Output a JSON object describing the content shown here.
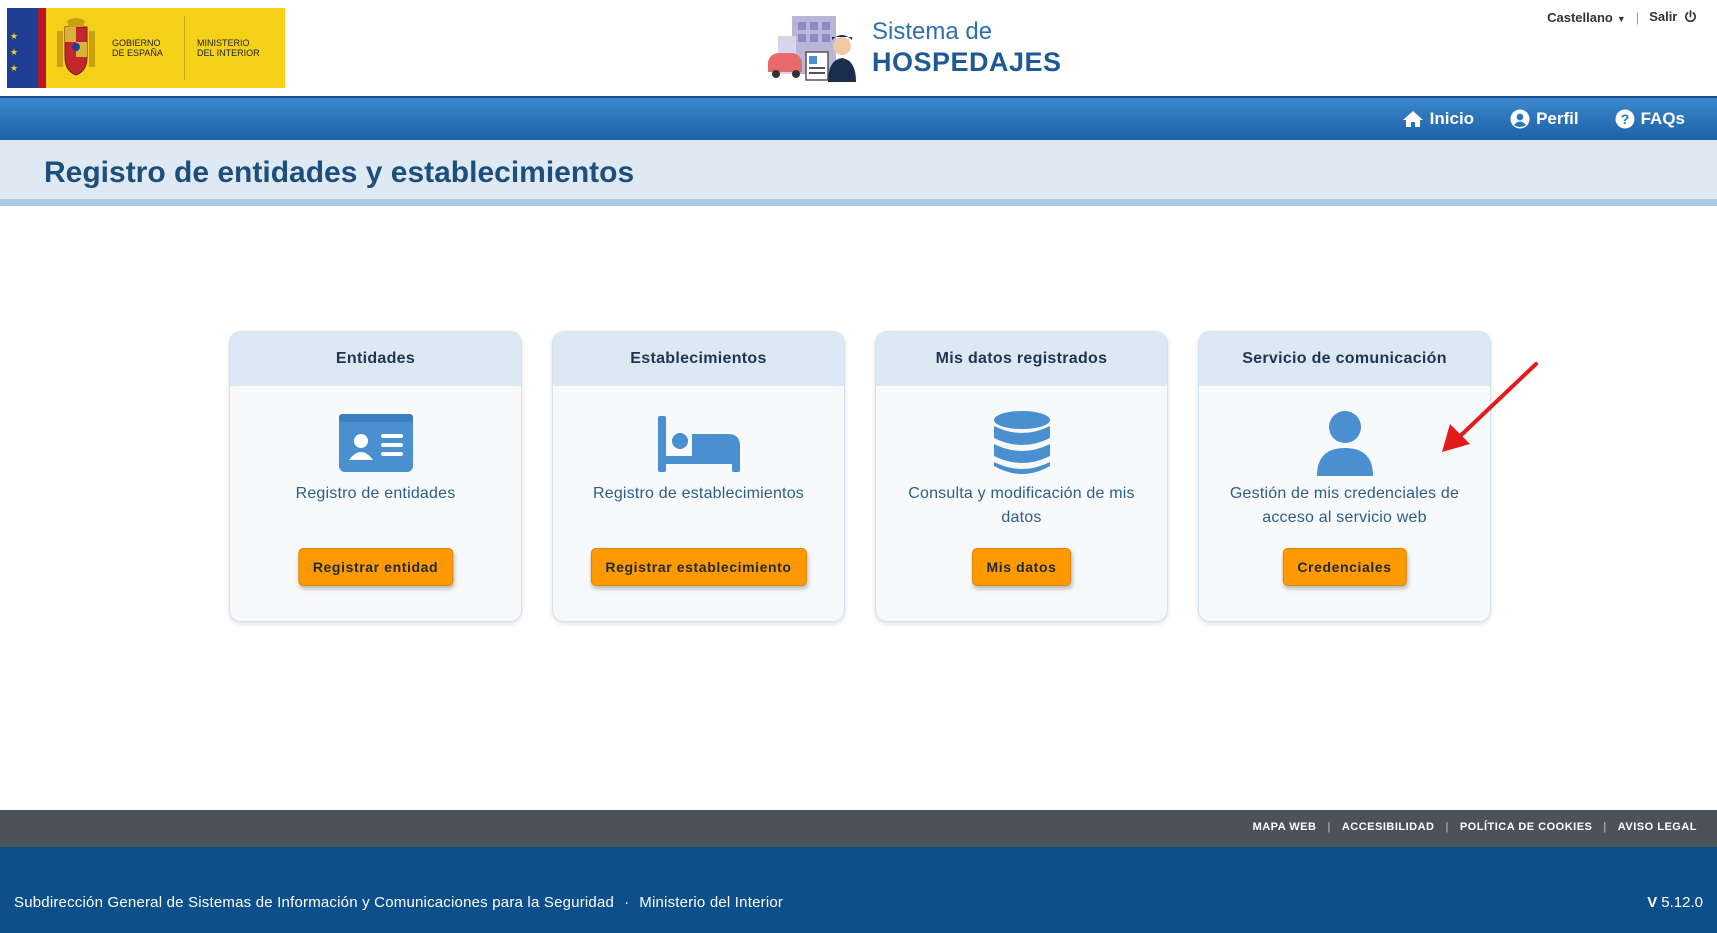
{
  "header": {
    "gov_logo": {
      "line1": "GOBIERNO",
      "line2": "DE ESPAÑA",
      "line3": "MINISTERIO",
      "line4": "DEL INTERIOR"
    },
    "brand": {
      "title_line1": "Sistema de",
      "title_line2": "HOSPEDAJES"
    },
    "language": "Castellano",
    "logout": "Salir"
  },
  "nav": {
    "items": [
      {
        "label": "Inicio",
        "icon": "home-icon"
      },
      {
        "label": "Perfil",
        "icon": "user-circle-icon"
      },
      {
        "label": "FAQs",
        "icon": "question-circle-icon"
      }
    ]
  },
  "page": {
    "title": "Registro de entidades y establecimientos"
  },
  "cards": [
    {
      "title": "Entidades",
      "icon": "id-card-icon",
      "description": "Registro de entidades",
      "button": "Registrar entidad"
    },
    {
      "title": "Establecimientos",
      "icon": "bed-icon",
      "description": "Registro de establecimientos",
      "button": "Registrar establecimiento"
    },
    {
      "title": "Mis datos registrados",
      "icon": "database-icon",
      "description": "Consulta y modificación de mis datos",
      "button": "Mis datos"
    },
    {
      "title": "Servicio de comunicación",
      "icon": "user-icon",
      "description": "Gestión de mis credenciales de acceso al servicio web",
      "button": "Credenciales"
    }
  ],
  "colors": {
    "accent_button": "#ff9900",
    "navbar": "#2c74ba",
    "title_band": "#dfe9f4",
    "footer": "#0d4f8b",
    "icon_blue": "#4a8fcf",
    "annotation_arrow": "#e31b1b"
  },
  "footer": {
    "links": [
      "MAPA WEB",
      "ACCESIBILIDAD",
      "POLÍTICA DE COOKIES",
      "AVISO LEGAL"
    ],
    "organization": "Subdirección General de Sistemas de Información y Comunicaciones para la Seguridad",
    "ministry": "Ministerio del Interior",
    "version_prefix": "V",
    "version": "5.12.0"
  }
}
